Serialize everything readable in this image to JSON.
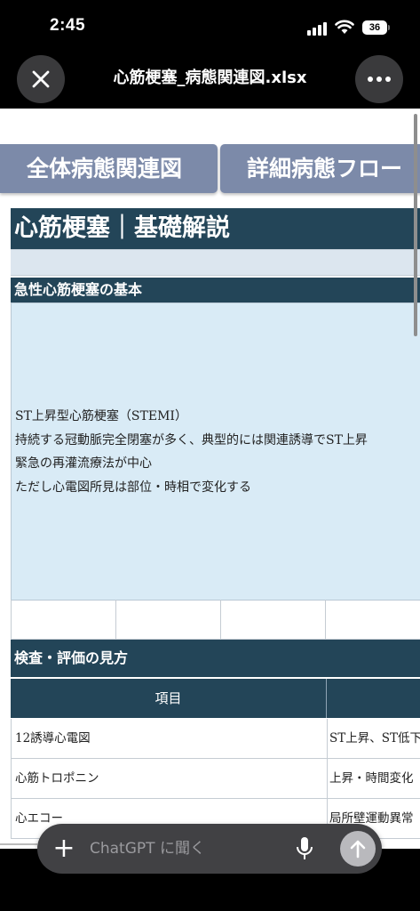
{
  "status": {
    "time": "2:45",
    "battery": "36"
  },
  "nav": {
    "title": "心筋梗塞_病態関連図.xlsx"
  },
  "tabs": [
    {
      "label": "全体病態関連図"
    },
    {
      "label": "詳細病態フロー"
    }
  ],
  "sheet": {
    "title": "心筋梗塞｜基礎解説",
    "section1": "急性心筋梗塞の基本",
    "body_lines": [
      "ST上昇型心筋梗塞（STEMI）",
      "持続する冠動脈完全閉塞が多く、典型的には関連誘導でST上昇",
      "緊急の再灌流療法が中心",
      "ただし心電図所見は部位・時相で変化する"
    ],
    "section2": "検査・評価の見方",
    "table_header": [
      "項目",
      ""
    ],
    "rows": [
      [
        "12誘導心電図",
        "ST上昇、ST低下"
      ],
      [
        "心筋トロポニン",
        "上昇・時間変化"
      ],
      [
        "心エコー",
        "局所壁運動異常"
      ]
    ]
  },
  "chat": {
    "placeholder": "ChatGPT に聞く"
  },
  "icons": {
    "close": "close-icon",
    "more": "more-icon",
    "plus": "plus-icon",
    "mic": "mic-icon",
    "send": "arrow-up-icon"
  },
  "colors": {
    "header": "#234558",
    "tab": "#7c8aa9",
    "body_bg": "#d9ebf6"
  }
}
